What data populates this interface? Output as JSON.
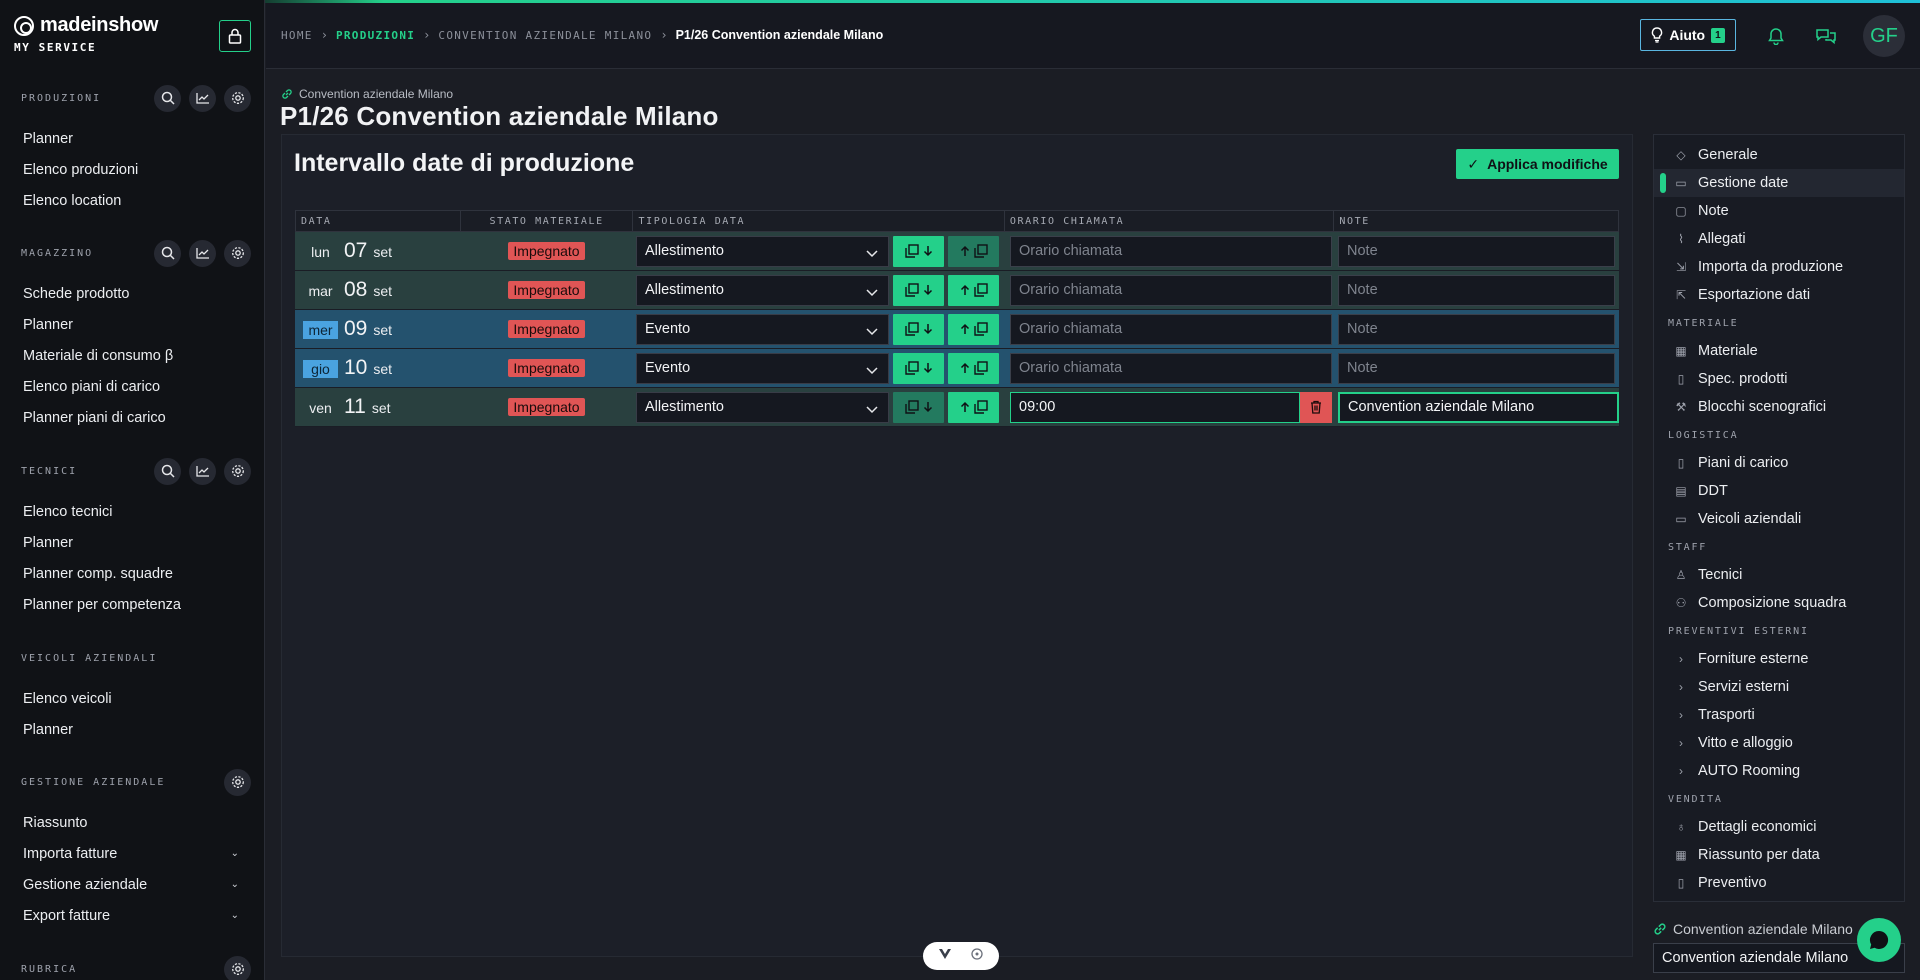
{
  "brand": {
    "name": "madeinshow",
    "sub": "MY SERVICE"
  },
  "sidebar": {
    "sections": [
      {
        "title": "PRODUZIONI",
        "items": [
          "Planner",
          "Elenco produzioni",
          "Elenco location"
        ]
      },
      {
        "title": "MAGAZZINO",
        "items": [
          "Schede prodotto",
          "Planner",
          "Materiale di consumo β",
          "Elenco piani di carico",
          "Planner piani di carico"
        ]
      },
      {
        "title": "TECNICI",
        "items": [
          "Elenco tecnici",
          "Planner",
          "Planner comp. squadre",
          "Planner per competenza"
        ]
      },
      {
        "title": "VEICOLI AZIENDALI",
        "items": [
          "Elenco veicoli",
          "Planner"
        ]
      },
      {
        "title": "GESTIONE AZIENDALE",
        "items": [
          "Riassunto",
          "Importa fatture",
          "Gestione aziendale",
          "Export fatture"
        ]
      },
      {
        "title": "RUBRICA",
        "items": []
      }
    ]
  },
  "breadcrumb": {
    "home": "HOME",
    "produzioni": "PRODUZIONI",
    "convention": "CONVENTION AZIENDALE MILANO",
    "current": "P1/26 Convention aziendale Milano"
  },
  "topbar": {
    "help_label": "Aiuto",
    "help_count": "1",
    "avatar_initials": "GF"
  },
  "page": {
    "project_link": "Convention aziendale Milano",
    "title": "P1/26 Convention aziendale Milano",
    "section_title": "Intervallo date di produzione",
    "apply_label": "Applica modifiche"
  },
  "table": {
    "headers": [
      "DATA",
      "STATO MATERIALE",
      "TIPOLOGIA DATA",
      "ORARIO CHIAMATA",
      "NOTE"
    ],
    "rows": [
      {
        "dow": "lun",
        "day": "07",
        "month": "set",
        "stato": "Impegnato",
        "tipo": "Allestimento",
        "orario": "",
        "orario_ph": "Orario chiamata",
        "note": "",
        "note_ph": "Note"
      },
      {
        "dow": "mar",
        "day": "08",
        "month": "set",
        "stato": "Impegnato",
        "tipo": "Allestimento",
        "orario": "",
        "orario_ph": "Orario chiamata",
        "note": "",
        "note_ph": "Note"
      },
      {
        "dow": "mer",
        "day": "09",
        "month": "set",
        "stato": "Impegnato",
        "tipo": "Evento",
        "orario": "",
        "orario_ph": "Orario chiamata",
        "note": "",
        "note_ph": "Note"
      },
      {
        "dow": "gio",
        "day": "10",
        "month": "set",
        "stato": "Impegnato",
        "tipo": "Evento",
        "orario": "",
        "orario_ph": "Orario chiamata",
        "note": "",
        "note_ph": "Note"
      },
      {
        "dow": "ven",
        "day": "11",
        "month": "set",
        "stato": "Impegnato",
        "tipo": "Allestimento",
        "orario": "09:00",
        "orario_ph": "Orario chiamata",
        "note": "Convention aziendale Milano",
        "note_ph": "Note"
      }
    ]
  },
  "right_nav": {
    "top_items": [
      "Generale",
      "Gestione date",
      "Note",
      "Allegati",
      "Importa da produzione",
      "Esportazione dati"
    ],
    "groups": [
      {
        "title": "MATERIALE",
        "items": [
          "Materiale",
          "Spec. prodotti",
          "Blocchi scenografici"
        ]
      },
      {
        "title": "LOGISTICA",
        "items": [
          "Piani di carico",
          "DDT",
          "Veicoli aziendali"
        ]
      },
      {
        "title": "STAFF",
        "items": [
          "Tecnici",
          "Composizione squadra"
        ]
      },
      {
        "title": "PREVENTIVI ESTERNI",
        "items": [
          "Forniture esterne",
          "Servizi esterni",
          "Trasporti",
          "Vitto e alloggio",
          "AUTO Rooming"
        ]
      },
      {
        "title": "VENDITA",
        "items": [
          "Dettagli economici",
          "Riassunto per data",
          "Preventivo"
        ]
      }
    ],
    "active": "Gestione date",
    "bottom_link": "Convention aziendale Milano",
    "bottom_select": "Convention aziendale Milano"
  },
  "colors": {
    "accent": "#24d08a",
    "danger": "#e05555",
    "highlight": "#4aa3e0"
  }
}
